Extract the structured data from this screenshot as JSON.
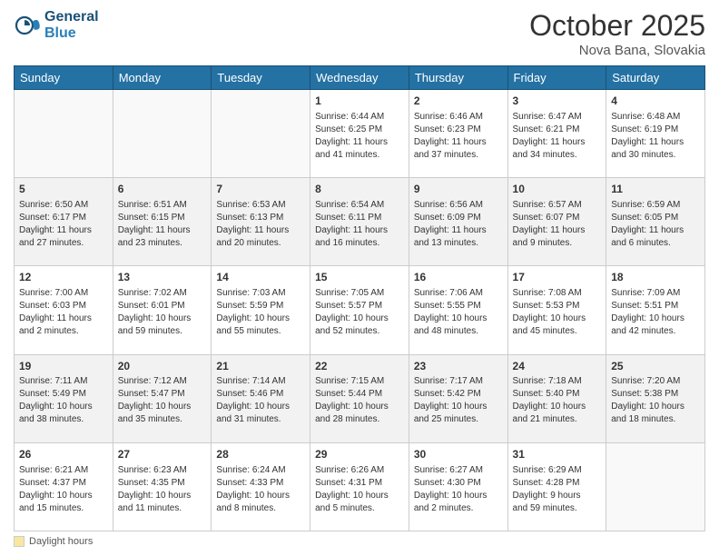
{
  "header": {
    "logo_general": "General",
    "logo_blue": "Blue",
    "month": "October 2025",
    "location": "Nova Bana, Slovakia"
  },
  "days_of_week": [
    "Sunday",
    "Monday",
    "Tuesday",
    "Wednesday",
    "Thursday",
    "Friday",
    "Saturday"
  ],
  "footer": {
    "label": "Daylight hours"
  },
  "weeks": [
    {
      "shaded": false,
      "days": [
        {
          "num": "",
          "empty": true,
          "lines": []
        },
        {
          "num": "",
          "empty": true,
          "lines": []
        },
        {
          "num": "",
          "empty": true,
          "lines": []
        },
        {
          "num": "1",
          "empty": false,
          "lines": [
            "Sunrise: 6:44 AM",
            "Sunset: 6:25 PM",
            "Daylight: 11 hours",
            "and 41 minutes."
          ]
        },
        {
          "num": "2",
          "empty": false,
          "lines": [
            "Sunrise: 6:46 AM",
            "Sunset: 6:23 PM",
            "Daylight: 11 hours",
            "and 37 minutes."
          ]
        },
        {
          "num": "3",
          "empty": false,
          "lines": [
            "Sunrise: 6:47 AM",
            "Sunset: 6:21 PM",
            "Daylight: 11 hours",
            "and 34 minutes."
          ]
        },
        {
          "num": "4",
          "empty": false,
          "lines": [
            "Sunrise: 6:48 AM",
            "Sunset: 6:19 PM",
            "Daylight: 11 hours",
            "and 30 minutes."
          ]
        }
      ]
    },
    {
      "shaded": true,
      "days": [
        {
          "num": "5",
          "empty": false,
          "lines": [
            "Sunrise: 6:50 AM",
            "Sunset: 6:17 PM",
            "Daylight: 11 hours",
            "and 27 minutes."
          ]
        },
        {
          "num": "6",
          "empty": false,
          "lines": [
            "Sunrise: 6:51 AM",
            "Sunset: 6:15 PM",
            "Daylight: 11 hours",
            "and 23 minutes."
          ]
        },
        {
          "num": "7",
          "empty": false,
          "lines": [
            "Sunrise: 6:53 AM",
            "Sunset: 6:13 PM",
            "Daylight: 11 hours",
            "and 20 minutes."
          ]
        },
        {
          "num": "8",
          "empty": false,
          "lines": [
            "Sunrise: 6:54 AM",
            "Sunset: 6:11 PM",
            "Daylight: 11 hours",
            "and 16 minutes."
          ]
        },
        {
          "num": "9",
          "empty": false,
          "lines": [
            "Sunrise: 6:56 AM",
            "Sunset: 6:09 PM",
            "Daylight: 11 hours",
            "and 13 minutes."
          ]
        },
        {
          "num": "10",
          "empty": false,
          "lines": [
            "Sunrise: 6:57 AM",
            "Sunset: 6:07 PM",
            "Daylight: 11 hours",
            "and 9 minutes."
          ]
        },
        {
          "num": "11",
          "empty": false,
          "lines": [
            "Sunrise: 6:59 AM",
            "Sunset: 6:05 PM",
            "Daylight: 11 hours",
            "and 6 minutes."
          ]
        }
      ]
    },
    {
      "shaded": false,
      "days": [
        {
          "num": "12",
          "empty": false,
          "lines": [
            "Sunrise: 7:00 AM",
            "Sunset: 6:03 PM",
            "Daylight: 11 hours",
            "and 2 minutes."
          ]
        },
        {
          "num": "13",
          "empty": false,
          "lines": [
            "Sunrise: 7:02 AM",
            "Sunset: 6:01 PM",
            "Daylight: 10 hours",
            "and 59 minutes."
          ]
        },
        {
          "num": "14",
          "empty": false,
          "lines": [
            "Sunrise: 7:03 AM",
            "Sunset: 5:59 PM",
            "Daylight: 10 hours",
            "and 55 minutes."
          ]
        },
        {
          "num": "15",
          "empty": false,
          "lines": [
            "Sunrise: 7:05 AM",
            "Sunset: 5:57 PM",
            "Daylight: 10 hours",
            "and 52 minutes."
          ]
        },
        {
          "num": "16",
          "empty": false,
          "lines": [
            "Sunrise: 7:06 AM",
            "Sunset: 5:55 PM",
            "Daylight: 10 hours",
            "and 48 minutes."
          ]
        },
        {
          "num": "17",
          "empty": false,
          "lines": [
            "Sunrise: 7:08 AM",
            "Sunset: 5:53 PM",
            "Daylight: 10 hours",
            "and 45 minutes."
          ]
        },
        {
          "num": "18",
          "empty": false,
          "lines": [
            "Sunrise: 7:09 AM",
            "Sunset: 5:51 PM",
            "Daylight: 10 hours",
            "and 42 minutes."
          ]
        }
      ]
    },
    {
      "shaded": true,
      "days": [
        {
          "num": "19",
          "empty": false,
          "lines": [
            "Sunrise: 7:11 AM",
            "Sunset: 5:49 PM",
            "Daylight: 10 hours",
            "and 38 minutes."
          ]
        },
        {
          "num": "20",
          "empty": false,
          "lines": [
            "Sunrise: 7:12 AM",
            "Sunset: 5:47 PM",
            "Daylight: 10 hours",
            "and 35 minutes."
          ]
        },
        {
          "num": "21",
          "empty": false,
          "lines": [
            "Sunrise: 7:14 AM",
            "Sunset: 5:46 PM",
            "Daylight: 10 hours",
            "and 31 minutes."
          ]
        },
        {
          "num": "22",
          "empty": false,
          "lines": [
            "Sunrise: 7:15 AM",
            "Sunset: 5:44 PM",
            "Daylight: 10 hours",
            "and 28 minutes."
          ]
        },
        {
          "num": "23",
          "empty": false,
          "lines": [
            "Sunrise: 7:17 AM",
            "Sunset: 5:42 PM",
            "Daylight: 10 hours",
            "and 25 minutes."
          ]
        },
        {
          "num": "24",
          "empty": false,
          "lines": [
            "Sunrise: 7:18 AM",
            "Sunset: 5:40 PM",
            "Daylight: 10 hours",
            "and 21 minutes."
          ]
        },
        {
          "num": "25",
          "empty": false,
          "lines": [
            "Sunrise: 7:20 AM",
            "Sunset: 5:38 PM",
            "Daylight: 10 hours",
            "and 18 minutes."
          ]
        }
      ]
    },
    {
      "shaded": false,
      "days": [
        {
          "num": "26",
          "empty": false,
          "lines": [
            "Sunrise: 6:21 AM",
            "Sunset: 4:37 PM",
            "Daylight: 10 hours",
            "and 15 minutes."
          ]
        },
        {
          "num": "27",
          "empty": false,
          "lines": [
            "Sunrise: 6:23 AM",
            "Sunset: 4:35 PM",
            "Daylight: 10 hours",
            "and 11 minutes."
          ]
        },
        {
          "num": "28",
          "empty": false,
          "lines": [
            "Sunrise: 6:24 AM",
            "Sunset: 4:33 PM",
            "Daylight: 10 hours",
            "and 8 minutes."
          ]
        },
        {
          "num": "29",
          "empty": false,
          "lines": [
            "Sunrise: 6:26 AM",
            "Sunset: 4:31 PM",
            "Daylight: 10 hours",
            "and 5 minutes."
          ]
        },
        {
          "num": "30",
          "empty": false,
          "lines": [
            "Sunrise: 6:27 AM",
            "Sunset: 4:30 PM",
            "Daylight: 10 hours",
            "and 2 minutes."
          ]
        },
        {
          "num": "31",
          "empty": false,
          "lines": [
            "Sunrise: 6:29 AM",
            "Sunset: 4:28 PM",
            "Daylight: 9 hours",
            "and 59 minutes."
          ]
        },
        {
          "num": "",
          "empty": true,
          "lines": []
        }
      ]
    }
  ]
}
